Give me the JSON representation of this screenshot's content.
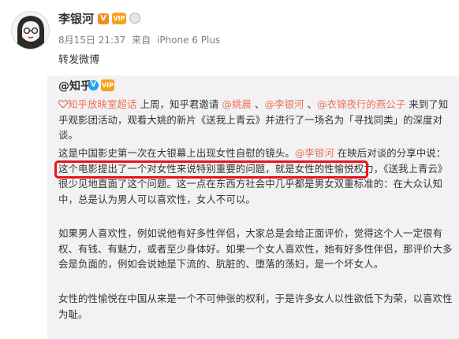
{
  "post": {
    "author_name": "李银河",
    "verified_badge": "V",
    "vip_badge": "VIP",
    "date": "8月15日 21:37",
    "source_prefix": "来自",
    "device": "iPhone 6 Plus",
    "content": "转发微博"
  },
  "quoted": {
    "author": "@知乎",
    "verified_badge": "V",
    "vip_badge": "VIP",
    "p1": {
      "topic": "知乎放映室超话",
      "t1": " 上周，知乎君邀请 ",
      "m1": "@姚晨",
      "s1": " 、",
      "m2": "@李银河",
      "s2": " 、",
      "m3": "@衣锦夜行的燕公子",
      "t2": " 来到了知乎观影团活动，观看大姚的新片《送我上青云》并进行了一场名为「寻找同类」的深度对谈。"
    },
    "p2": {
      "t1": "这是中国影史第一次在大银幕上出现女性自慰的镜头。",
      "m1": "@李银河",
      "t2": " 在映后对谈的分享中说：这个电影提出了一个对女性来说特别重要的问题，就是女性的性愉悦权力，《送我上青云》很少见地直面了这个问题。这一点在东西方社会中几乎都是男女双重标准的：在大众认知中，总是认为男人可以喜欢性，女人不可以。"
    },
    "p3": "如果男人喜欢性，例如说他有好多性伴侣，大家总是会给正面评价，觉得这个人一定很有权、有钱、有魅力，或者至少身体好。如果一个女人喜欢性，她有好多性伴侣，那评价大多会是负面的，例如会说她是下流的、肮脏的、堕落的荡妇，是一个坏女人。",
    "p4": "女性的性愉悦在中国从来是一个不可伸张的权利，于是许多女人以性欲低下为荣，以喜欢性为耻。"
  },
  "colors": {
    "link": "#eb7350",
    "highlight_box": "#e8141c",
    "quoted_bg": "#f2f2f5"
  }
}
